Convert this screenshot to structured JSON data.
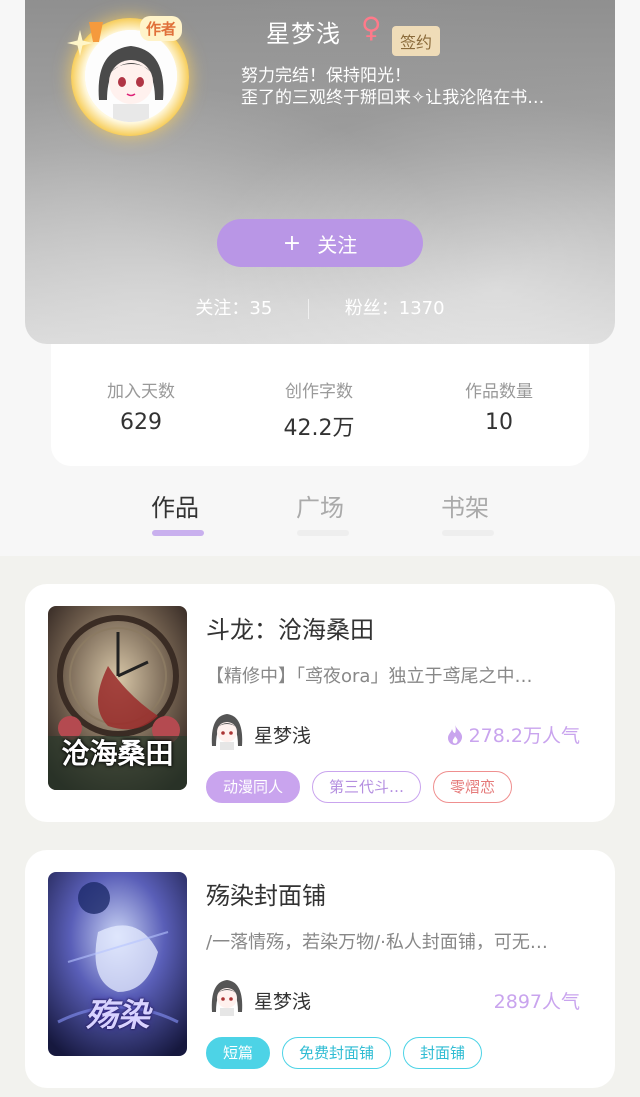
{
  "profile": {
    "name": "星梦浅",
    "gender_symbol": "♀",
    "signed_badge": "签约",
    "author_badge": "作者",
    "bio_line1": "努力完结！保持阳光！",
    "bio_line2": "歪了的三观终于掰回来✧让我沦陷在书…",
    "follow_button": {
      "icon": "+",
      "label": "关注"
    },
    "following": "关注：35",
    "fans": "粉丝：1370"
  },
  "stats": [
    {
      "label": "加入天数",
      "value": "629"
    },
    {
      "label": "创作字数",
      "value": "42.2万"
    },
    {
      "label": "作品数量",
      "value": "10"
    }
  ],
  "tabs": [
    {
      "label": "作品",
      "active": true
    },
    {
      "label": "广场",
      "active": false
    },
    {
      "label": "书架",
      "active": false
    }
  ],
  "books": [
    {
      "title": "斗龙：沧海桑田",
      "description": "【精修中】「鸢夜ora」独立于鸢尾之中…",
      "author": "星梦浅",
      "popularity": "278.2万人气",
      "popularity_icon": "flame-icon",
      "cover_text": "沧海桑田",
      "tags": [
        {
          "label": "动漫同人",
          "style": "filled",
          "color": "#c9a4ee"
        },
        {
          "label": "第三代斗…",
          "style": "outline",
          "color": "#c9a4ee"
        },
        {
          "label": "零熠恋",
          "style": "outline",
          "color": "#ef8f8f"
        }
      ]
    },
    {
      "title": "殇染封面铺",
      "description": "/一落情殇，若染万物/·私人封面铺，可无…",
      "author": "星梦浅",
      "popularity": "2897人气",
      "cover_text": "殇染",
      "tags": [
        {
          "label": "短篇",
          "style": "filled",
          "color": "#4dd3e6"
        },
        {
          "label": "免费封面铺",
          "style": "outline",
          "color": "#4dd3e6"
        },
        {
          "label": "封面铺",
          "style": "outline",
          "color": "#4dd3e6"
        }
      ]
    }
  ]
}
